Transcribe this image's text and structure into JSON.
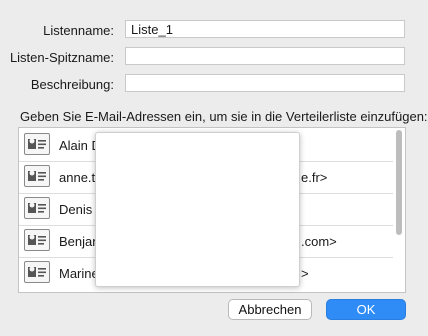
{
  "form": {
    "list_name_label": "Listenname:",
    "list_name_value": "Liste_1",
    "nickname_label": "Listen-Spitzname:",
    "nickname_value": "",
    "description_label": "Beschreibung:",
    "description_value": ""
  },
  "instruction": "Geben Sie E-Mail-Adressen ein, um sie in die Verteilerliste einzufügen:",
  "recipients": [
    {
      "icon": "contact-card-icon",
      "text_left": "Alain D",
      "text_right": ""
    },
    {
      "icon": "contact-card-icon",
      "text_left": "anne.t",
      "text_right": "e.fr>"
    },
    {
      "icon": "contact-card-icon",
      "text_left": "Denis G",
      "text_right": ""
    },
    {
      "icon": "contact-card-icon",
      "text_left": "Benjan",
      "text_right": ".com>"
    },
    {
      "icon": "contact-card-icon",
      "text_left": "Marine",
      "text_right": ">"
    }
  ],
  "buttons": {
    "cancel": "Abbrechen",
    "ok": "OK"
  },
  "colors": {
    "ok_button": "#2f8cf7",
    "background": "#ececec"
  }
}
